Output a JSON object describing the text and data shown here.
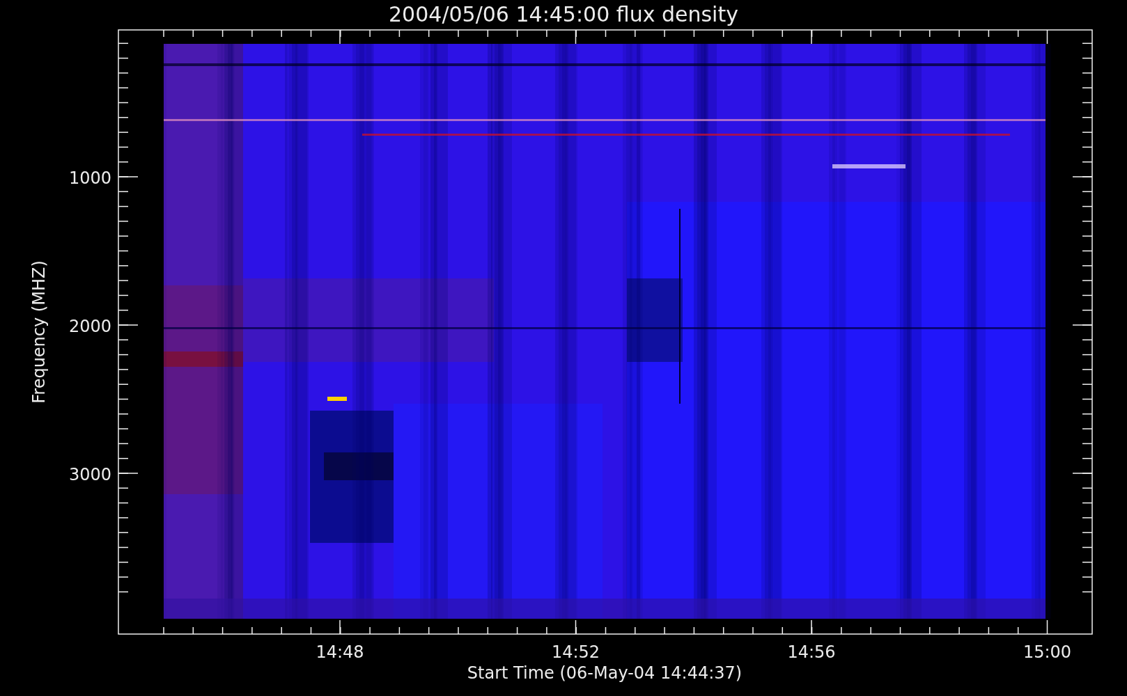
{
  "title": "2004/05/06 14:45:00 flux density",
  "y_axis": {
    "title": "Frequency (MHZ)",
    "tick_labels": [
      "1000",
      "2000",
      "3000"
    ]
  },
  "x_axis": {
    "title": "Start Time (06-May-04 14:44:37)",
    "tick_labels": [
      "14:48",
      "14:52",
      "14:56",
      "15:00"
    ]
  }
}
